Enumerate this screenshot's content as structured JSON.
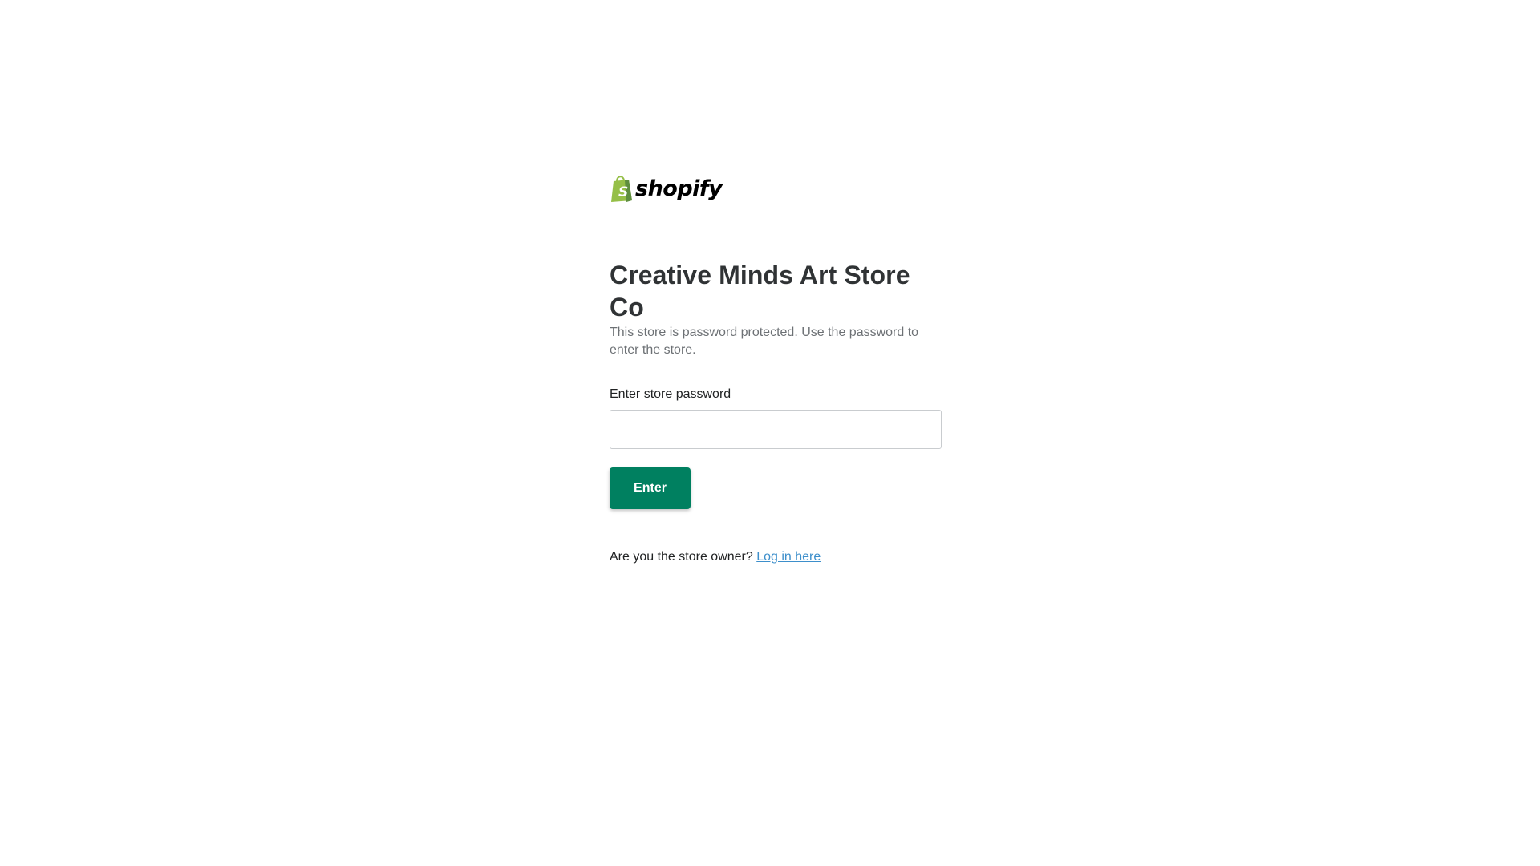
{
  "logo": {
    "wordmark": "shopify",
    "icon": "shopify-bag-icon",
    "bag_color": "#95bf47",
    "bag_shade_color": "#5e8e3e"
  },
  "store": {
    "title": "Creative Minds Art Store Co",
    "description": "This store is password protected. Use the password to enter the store."
  },
  "form": {
    "password_label": "Enter store password",
    "password_value": "",
    "submit_label": "Enter",
    "accent_color": "#008060"
  },
  "footer": {
    "owner_prompt": "Are you the store owner?",
    "login_link": "Log in here"
  }
}
